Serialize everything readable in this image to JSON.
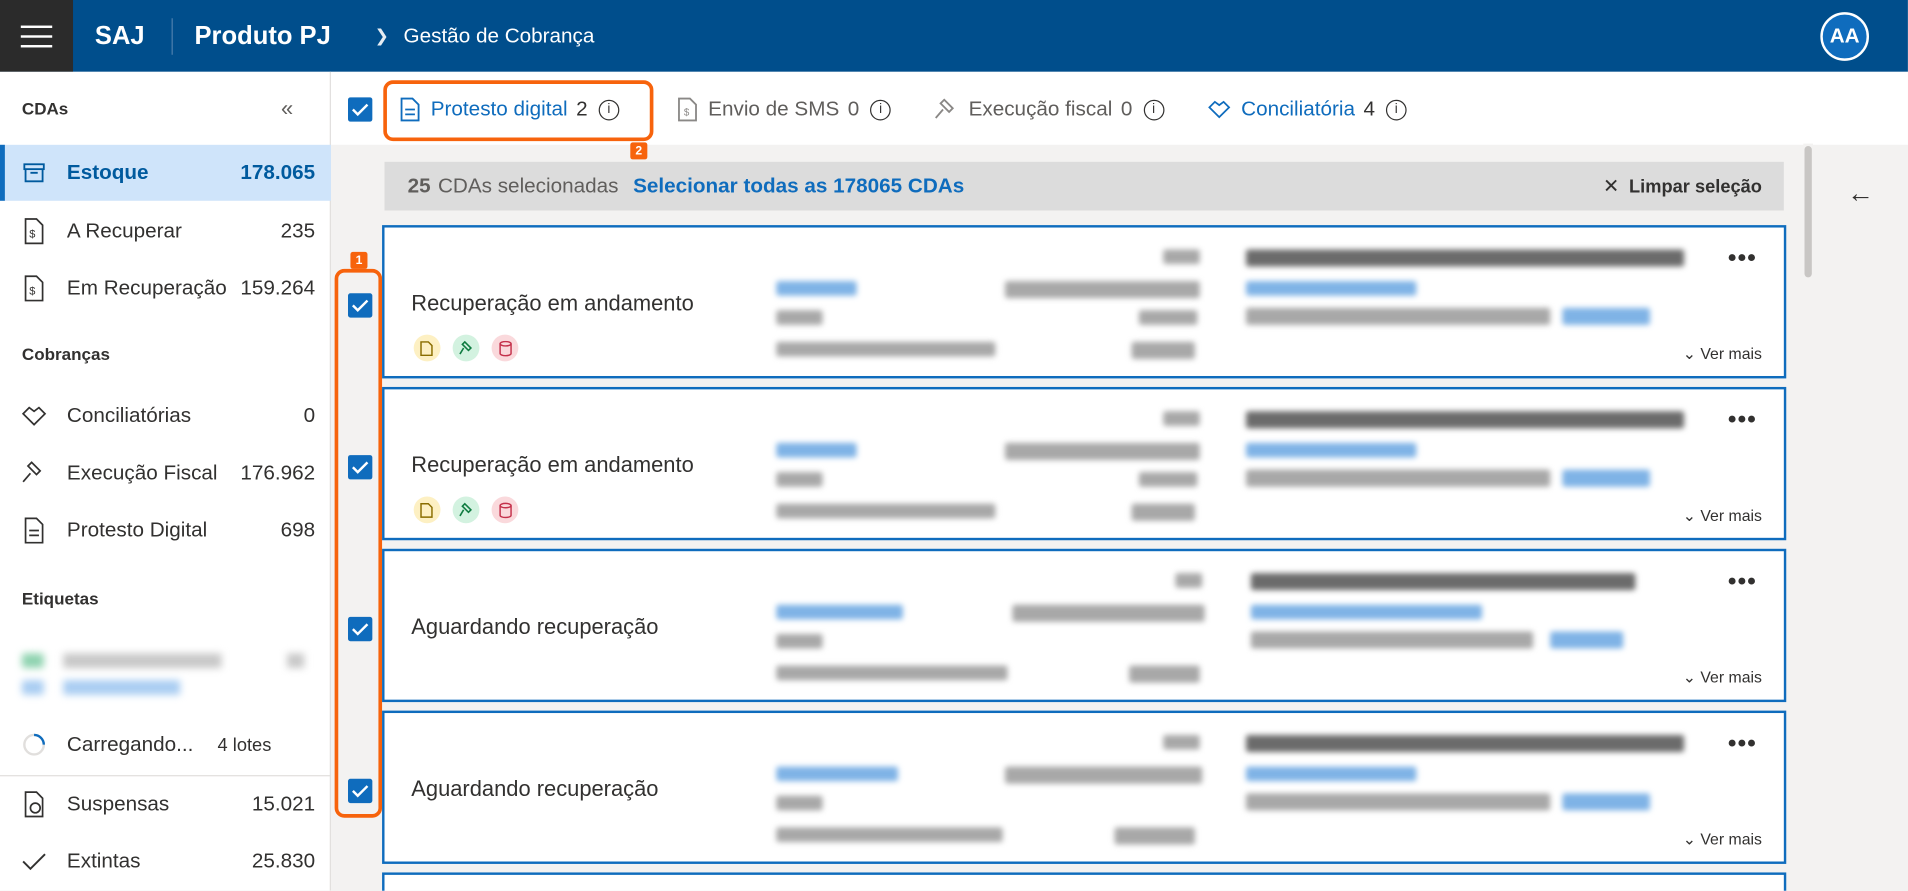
{
  "header": {
    "brand": "SAJ",
    "product": "Produto PJ",
    "breadcrumb": "Gestão de Cobrança",
    "avatar": "AA"
  },
  "sidebar": {
    "cdas_title": "CDAs",
    "cdas": [
      {
        "label": "Estoque",
        "count": "178.065",
        "icon": "archive-icon"
      },
      {
        "label": "A Recuperar",
        "count": "235",
        "icon": "document-money-icon"
      },
      {
        "label": "Em Recuperação",
        "count": "159.264",
        "icon": "document-sync-icon"
      }
    ],
    "cobrancas_title": "Cobranças",
    "cobrancas": [
      {
        "label": "Conciliatórias",
        "count": "0",
        "icon": "handshake-icon"
      },
      {
        "label": "Execução Fiscal",
        "count": "176.962",
        "icon": "gavel-icon"
      },
      {
        "label": "Protesto Digital",
        "count": "698",
        "icon": "document-protest-icon"
      }
    ],
    "etiquetas_title": "Etiquetas",
    "loading": {
      "label": "Carregando...",
      "count": "4 lotes"
    },
    "footer": [
      {
        "label": "Suspensas",
        "count": "15.021",
        "icon": "document-paused-icon"
      },
      {
        "label": "Extintas",
        "count": "25.830",
        "icon": "checkmark-icon"
      }
    ]
  },
  "tabs": [
    {
      "label": "Protesto digital",
      "count": "2"
    },
    {
      "label": "Envio de SMS",
      "count": "0"
    },
    {
      "label": "Execução fiscal",
      "count": "0"
    },
    {
      "label": "Conciliatória",
      "count": "4"
    }
  ],
  "annotations": {
    "badge1": "1",
    "badge2": "2"
  },
  "selection": {
    "count": "25",
    "text": "CDAs selecionadas",
    "select_all": "Selecionar todas as 178065 CDAs",
    "clear": "Limpar seleção"
  },
  "cards": [
    {
      "status": "Recuperação em andamento",
      "more": "Ver mais"
    },
    {
      "status": "Recuperação em andamento",
      "more": "Ver mais"
    },
    {
      "status": "Aguardando recuperação",
      "more": "Ver mais"
    },
    {
      "status": "Aguardando recuperação",
      "more": "Ver mais"
    }
  ],
  "colors": {
    "header": "#004e8c",
    "accent": "#0f6cbd",
    "annotation": "#f7630c",
    "active_nav": "#cfe4fa"
  }
}
